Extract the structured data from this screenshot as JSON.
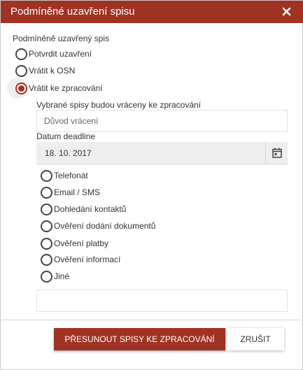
{
  "dialog": {
    "title": "Podmíněné uzavření spisu",
    "close_icon": "close-icon"
  },
  "closing": {
    "section_label": "Podmíněně uzavřený spis",
    "options": [
      {
        "label": "Potvrdit uzavření",
        "checked": false
      },
      {
        "label": "Vrátit k OSN",
        "checked": false
      },
      {
        "label": "Vrátit ke zpracování",
        "checked": true
      }
    ]
  },
  "return_form": {
    "info_text": "Vybrané spisy budou vráceny ke zpracování",
    "reason_placeholder": "Důvod vrácení",
    "deadline_label": "Datum deadline",
    "deadline_value": "18. 10. 2017",
    "calendar_icon": "calendar-icon",
    "reason_types": [
      {
        "label": "Telefonát",
        "checked": false
      },
      {
        "label": "Email / SMS",
        "checked": false
      },
      {
        "label": "Dohledání kontaktů",
        "checked": false
      },
      {
        "label": "Ověření dodání dokumentů",
        "checked": false
      },
      {
        "label": "Ověření platby",
        "checked": false
      },
      {
        "label": "Ověření informací",
        "checked": false
      },
      {
        "label": "Jiné",
        "checked": false
      }
    ],
    "note_value": ""
  },
  "actions": {
    "submit_label": "PŘESUNOUT SPISY KE ZPRACOVÁNÍ",
    "cancel_label": "ZRUŠIT"
  },
  "colors": {
    "accent": "#a03224",
    "field_bg": "#eeeeee"
  }
}
